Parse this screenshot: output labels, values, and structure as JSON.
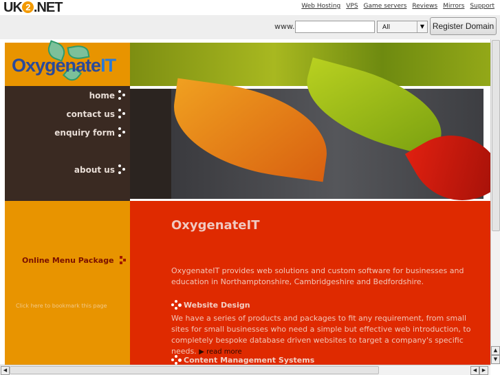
{
  "site_header": {
    "logo": "UK2.NET",
    "links": [
      "Web Hosting",
      "VPS",
      "Game servers",
      "Reviews",
      "Mirrors",
      "Support"
    ]
  },
  "domain_search": {
    "prefix": "www.",
    "value": "",
    "tld_selected": "All",
    "register_label": "Register Domain"
  },
  "site": {
    "logo": "OxygenateIT",
    "nav": [
      "home",
      "contact us",
      "enquiry form",
      "about us"
    ],
    "sidebar": {
      "package_link": "Online Menu Package",
      "bookmark_link": "Click here to bookmark this page"
    },
    "main": {
      "title": "OxygenateIT",
      "intro": "OxygenateIT provides web solutions and custom software for businesses and education in Northamptonshire, Cambridgeshire and Bedfordshire.",
      "sections": [
        {
          "heading": "Website Design",
          "body": "We have a series of products and packages to fit any requirement, from small sites for small businesses who need a simple but effective web introduction, to completely bespoke database driven websites to target a company's specific needs.",
          "read_more": "read more"
        },
        {
          "heading": "Content Management Systems"
        }
      ]
    }
  },
  "colors": {
    "orange": "#e89400",
    "red": "#df2a00",
    "brown": "#3a2a22"
  }
}
